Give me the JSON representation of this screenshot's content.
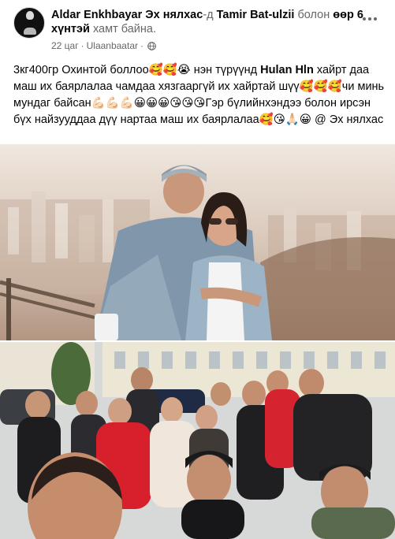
{
  "header": {
    "author": "Aldar Enkhbayar",
    "tagged_page": "Эх нялхас",
    "with_text": "-д",
    "tagged_person": "Tamir Bat-ulzii",
    "with_connector": "болон",
    "others": "өөр 6 хүнтэй",
    "with_suffix": "хамт байна.",
    "time": "22 цаг",
    "location": "Ulaanbaatar",
    "privacy_icon": "globe-icon",
    "avatar_logo_text": "ZRAAA"
  },
  "post": {
    "line1_a": "3кг400гр Охинтой боллоо🥰🥰😭 нэн түрүүнд ",
    "mention": "Hulan Hln",
    "line1_b": " хайрт даа маш их баярлалаа чамдаа хязгааргүй их хайртай шүү🥰🥰🥰чи минь мундаг байсан💪🏻💪🏻💪🏻😀😀😀😘😘😘Гэр бүлийнхэндээ болон ирсэн бүх найзууддаа дүү нартаа маш их баярлалаа🥰😘🙏🏻😀 @ Эх нялхас"
  },
  "photos": [
    {
      "name": "couple-photo"
    },
    {
      "name": "group-photo"
    }
  ]
}
